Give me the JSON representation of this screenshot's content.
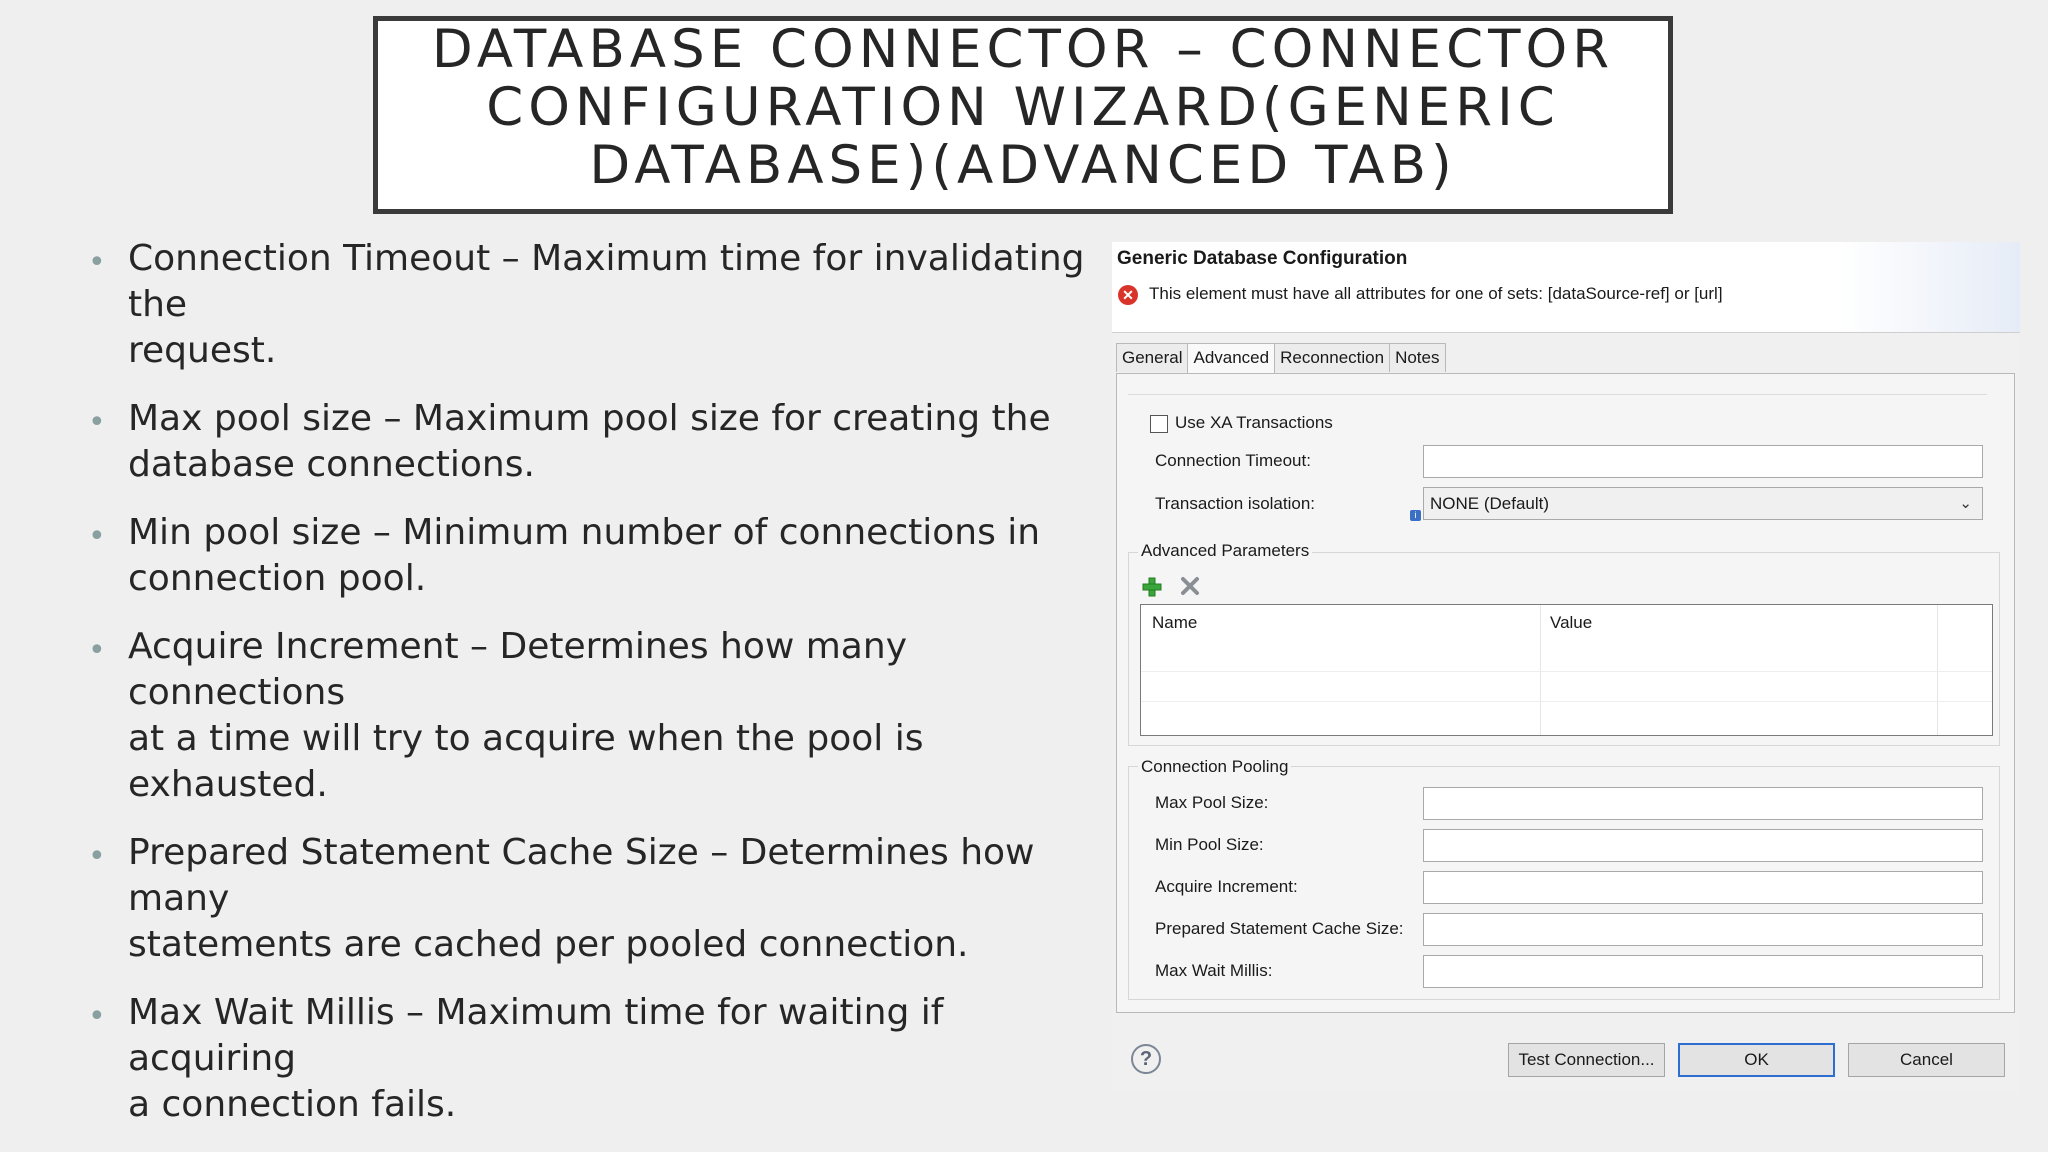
{
  "slide": {
    "title_lines": [
      "DATABASE CONNECTOR – CONNECTOR",
      "CONFIGURATION WIZARD(GENERIC",
      "DATABASE)(ADVANCED TAB)"
    ],
    "bullets": [
      {
        "line1": "Connection Timeout – Maximum time for invalidating the",
        "line2": "request."
      },
      {
        "line1": "Max pool size – Maximum pool size for creating the",
        "line2": "database connections."
      },
      {
        "line1": "Min pool size – Minimum number of connections in",
        "line2": "connection pool."
      },
      {
        "line1": "Acquire Increment – Determines how many connections",
        "line2": "at a time will try to acquire when the pool is exhausted."
      },
      {
        "line1": "Prepared Statement Cache Size – Determines how many",
        "line2": "statements are cached per pooled connection."
      },
      {
        "line1": "Max Wait Millis – Maximum time for waiting if acquiring",
        "line2": "a connection fails."
      }
    ]
  },
  "dialog": {
    "title": "Generic Database Configuration",
    "error_message": "This element must have all attributes for one of sets: [dataSource-ref] or [url]",
    "tabs": [
      "General",
      "Advanced",
      "Reconnection",
      "Notes"
    ],
    "active_tab": "Advanced",
    "use_xa_label": "Use XA Transactions",
    "connection_timeout_label": "Connection Timeout:",
    "connection_timeout_value": "",
    "transaction_isolation_label": "Transaction isolation:",
    "transaction_isolation_value": "NONE (Default)",
    "advanced_params": {
      "label": "Advanced Parameters",
      "columns": [
        "Name",
        "Value"
      ]
    },
    "pooling": {
      "label": "Connection Pooling",
      "fields": [
        {
          "label": "Max Pool Size:",
          "value": ""
        },
        {
          "label": "Min Pool Size:",
          "value": ""
        },
        {
          "label": "Acquire Increment:",
          "value": ""
        },
        {
          "label": "Prepared Statement Cache Size:",
          "value": ""
        },
        {
          "label": "Max Wait Millis:",
          "value": ""
        }
      ]
    },
    "buttons": {
      "help": "?",
      "test_connection": "Test Connection...",
      "ok": "OK",
      "cancel": "Cancel"
    },
    "colors": {
      "error": "#d9342b",
      "add_icon": "#3aa53a",
      "default_button_border": "#2d6fd0"
    }
  }
}
